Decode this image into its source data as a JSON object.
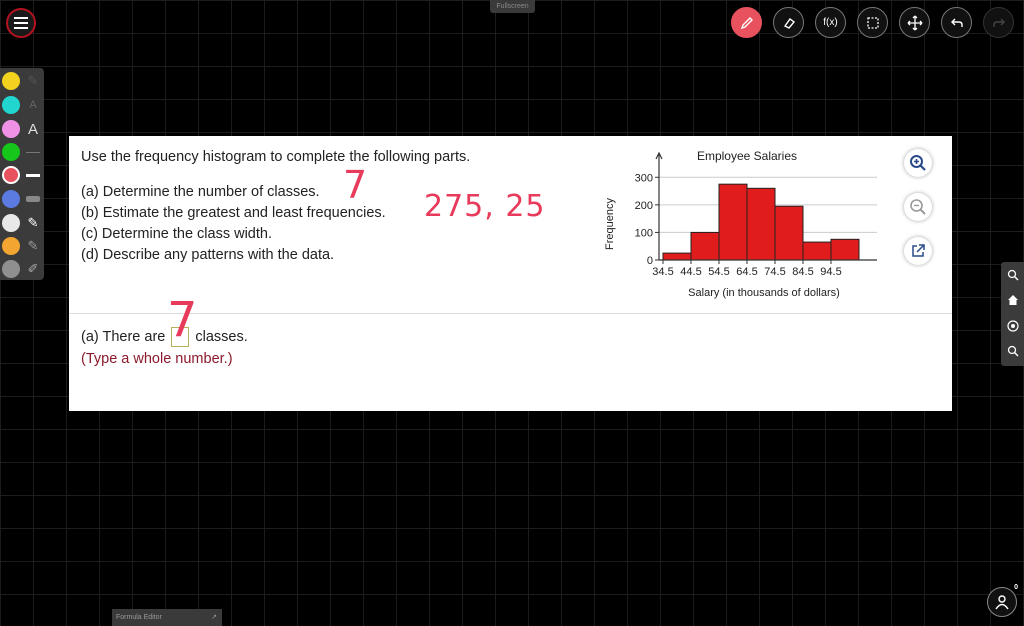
{
  "toolbar": {
    "fullscreen_label": "Fullscreen",
    "function_label": "f(x)"
  },
  "palette": {
    "colors": [
      "#f3d21f",
      "#20d6cf",
      "#ef92e6",
      "#16c61a",
      "#e8525f",
      "#5b7be0",
      "#e8e8e8",
      "#f3a531",
      "#8f8f8f"
    ],
    "text_tool_label": "A"
  },
  "question": {
    "title": "Use the frequency histogram to complete the following parts.",
    "parts": [
      "(a) Determine the number of classes.",
      "(b) Estimate the greatest and least frequencies.",
      "(c) Determine the class width.",
      "(d) Describe any patterns with the data."
    ],
    "answer_prefix": "(a) There are",
    "answer_suffix": "classes.",
    "answer_hint": "(Type a whole number.)"
  },
  "chart_data": {
    "type": "bar",
    "title": "Employee Salaries",
    "xlabel": "Salary (in thousands of dollars)",
    "ylabel": "Frequency",
    "categories": [
      "34.5",
      "44.5",
      "54.5",
      "64.5",
      "74.5",
      "84.5",
      "94.5"
    ],
    "values": [
      25,
      100,
      275,
      260,
      195,
      65,
      75
    ],
    "yticks": [
      0,
      100,
      200,
      300
    ],
    "ylim": [
      0,
      330
    ],
    "grid": true,
    "bar_color": "#e11c1c"
  },
  "annotations": {
    "classes_answer": "7",
    "frequencies": "275, 25"
  },
  "formula_editor_label": "Formula Editor",
  "users_count": "0"
}
